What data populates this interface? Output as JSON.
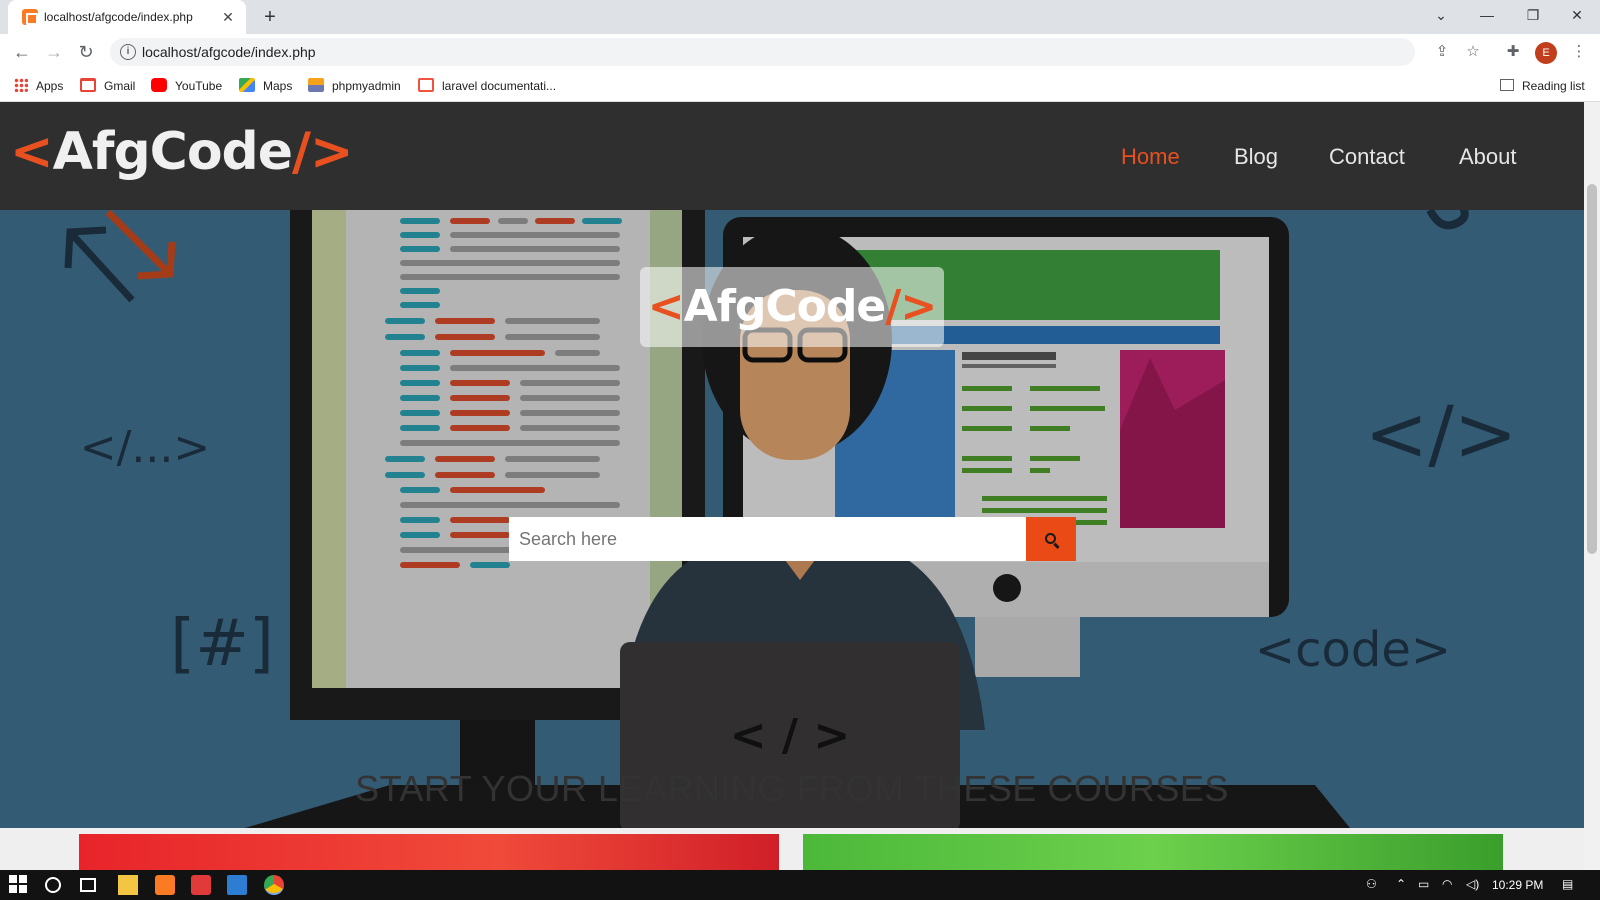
{
  "browser": {
    "tab_title": "localhost/afgcode/index.php",
    "url": "localhost/afgcode/index.php",
    "profile_initial": "E",
    "bookmarks": [
      {
        "label": "Apps",
        "icon": "apps-grid-icon"
      },
      {
        "label": "Gmail",
        "icon": "gmail-icon"
      },
      {
        "label": "YouTube",
        "icon": "youtube-icon"
      },
      {
        "label": "Maps",
        "icon": "maps-icon"
      },
      {
        "label": "phpmyadmin",
        "icon": "phpmyadmin-icon"
      },
      {
        "label": "laravel documentati...",
        "icon": "laravel-icon"
      }
    ],
    "reading_list": "Reading list"
  },
  "site": {
    "logo_open": "<",
    "logo_text": "AfgCode",
    "logo_slash": "/",
    "logo_close": ">",
    "nav": [
      {
        "label": "Home",
        "active": true
      },
      {
        "label": "Blog",
        "active": false
      },
      {
        "label": "Contact",
        "active": false
      },
      {
        "label": "About",
        "active": false
      }
    ],
    "hero": {
      "search_placeholder": "Search here",
      "deco_1": "</...>",
      "deco_2": "</>",
      "deco_3": "[#]",
      "deco_4": "<code>",
      "deco_5": "< / >"
    },
    "courses_title": "START YOUR LEARNING FROM THESE COURSES"
  },
  "taskbar": {
    "time": "10:29 PM"
  },
  "colors": {
    "accent": "#e8501f",
    "header_bg": "#2f2f2f",
    "hero_bg": "#3f6f8e"
  }
}
